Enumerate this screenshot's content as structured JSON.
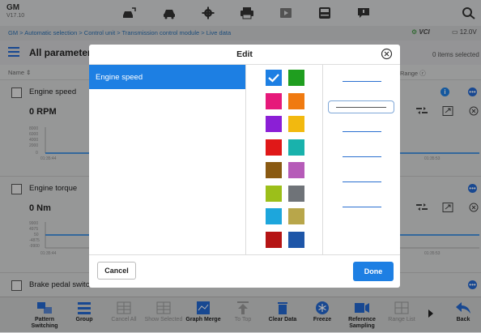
{
  "app": {
    "name": "GM",
    "version": "V17.10"
  },
  "toolbar_icons": [
    "car-dtc-icon",
    "car-icon",
    "gear-icon",
    "print-icon",
    "record-icon",
    "save-icon",
    "message-icon",
    "search-icon"
  ],
  "breadcrumb": "GM > Automatic selection > Control unit > Transmission control module > Live data",
  "status": {
    "vci": "VCI",
    "voltage": "12.0V"
  },
  "params": {
    "title": "All parameters",
    "selected_count": "0 items selected",
    "col_name": "Name ⇕",
    "col_range": "Range",
    "rows": [
      {
        "name": "Engine speed",
        "value": "0 RPM",
        "y_ticks": [
          "8000",
          "6000",
          "4000",
          "2000",
          "0"
        ],
        "x_ticks": [
          "01:35:44",
          "01:35:53"
        ]
      },
      {
        "name": "Engine torque",
        "value": "0 Nm",
        "y_ticks": [
          "9900",
          "4975",
          "50",
          "-4875",
          "-9900"
        ],
        "x_ticks": [
          "01:35:44",
          "01:35:53"
        ]
      },
      {
        "name": "Brake pedal switch"
      }
    ]
  },
  "bottom_bar": [
    {
      "label": "Pattern Switching",
      "enabled": true,
      "icon": "pattern-switch-icon"
    },
    {
      "label": "Group",
      "enabled": true,
      "icon": "group-icon"
    },
    {
      "label": "Cancel All",
      "enabled": false,
      "icon": "cancel-all-icon"
    },
    {
      "label": "Show Selected",
      "enabled": false,
      "icon": "show-selected-icon"
    },
    {
      "label": "Graph Merge",
      "enabled": true,
      "icon": "graph-merge-icon"
    },
    {
      "label": "To Top",
      "enabled": false,
      "icon": "to-top-icon"
    },
    {
      "label": "Clear Data",
      "enabled": true,
      "icon": "trash-icon"
    },
    {
      "label": "Freeze",
      "enabled": true,
      "icon": "snowflake-icon"
    },
    {
      "label": "Reference Sampling",
      "enabled": true,
      "icon": "reference-sampling-icon"
    },
    {
      "label": "Range List",
      "enabled": false,
      "icon": "range-list-icon"
    },
    {
      "label": "Back",
      "enabled": true,
      "icon": "back-icon"
    }
  ],
  "dialog": {
    "title": "Edit",
    "parameters": [
      {
        "label": "Engine speed",
        "selected": true
      }
    ],
    "colors": [
      {
        "hex": "#1d7fe3",
        "selected": true
      },
      {
        "hex": "#1f9e1f",
        "selected": false
      },
      {
        "hex": "#e6197a",
        "selected": false
      },
      {
        "hex": "#f07a10",
        "selected": false
      },
      {
        "hex": "#8b1fd6",
        "selected": false
      },
      {
        "hex": "#f2b90f",
        "selected": false
      },
      {
        "hex": "#e01818",
        "selected": false
      },
      {
        "hex": "#19b2ac",
        "selected": false
      },
      {
        "hex": "#8a5a12",
        "selected": false
      },
      {
        "hex": "#b65bb8",
        "selected": false
      },
      {
        "hex": "#9cbf1a",
        "selected": false
      },
      {
        "hex": "#6f7378",
        "selected": false
      },
      {
        "hex": "#1da6dc",
        "selected": false
      },
      {
        "hex": "#b8a64a",
        "selected": false
      },
      {
        "hex": "#b51414",
        "selected": false
      },
      {
        "hex": "#1e56a8",
        "selected": false
      }
    ],
    "line_styles": [
      {
        "name": "line-style-1",
        "selected": false
      },
      {
        "name": "line-style-2",
        "selected": true
      },
      {
        "name": "line-style-3",
        "selected": false
      },
      {
        "name": "line-style-4",
        "selected": false
      },
      {
        "name": "line-style-5",
        "selected": false
      },
      {
        "name": "line-style-6",
        "selected": false
      }
    ],
    "cancel_label": "Cancel",
    "done_label": "Done"
  }
}
